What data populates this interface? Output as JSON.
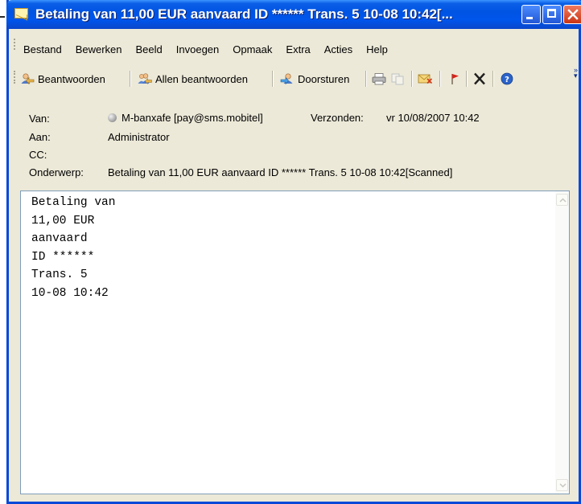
{
  "window": {
    "title": "Betaling van 11,00 EUR aanvaard ID ****** Trans. 5 10-08 10:42[..."
  },
  "menu": [
    "Bestand",
    "Bewerken",
    "Beeld",
    "Invoegen",
    "Opmaak",
    "Extra",
    "Acties",
    "Help"
  ],
  "toolbar": {
    "reply": "Beantwoorden",
    "reply_all": "Allen beantwoorden",
    "forward": "Doorsturen"
  },
  "header": {
    "from_label": "Van:",
    "from_value": "M-banxafe [pay@sms.mobitel]",
    "sent_label": "Verzonden:",
    "sent_value": "vr 10/08/2007 10:42",
    "to_label": "Aan:",
    "to_value": "Administrator",
    "cc_label": "CC:",
    "cc_value": "",
    "subject_label": "Onderwerp:",
    "subject_value": "Betaling van 11,00 EUR aanvaard ID ****** Trans. 5 10-08 10:42[Scanned]"
  },
  "body": {
    "lines": [
      "Betaling van",
      "11,00 EUR",
      "aanvaard",
      "ID ******",
      "Trans. 5",
      "10-08 10:42"
    ]
  }
}
